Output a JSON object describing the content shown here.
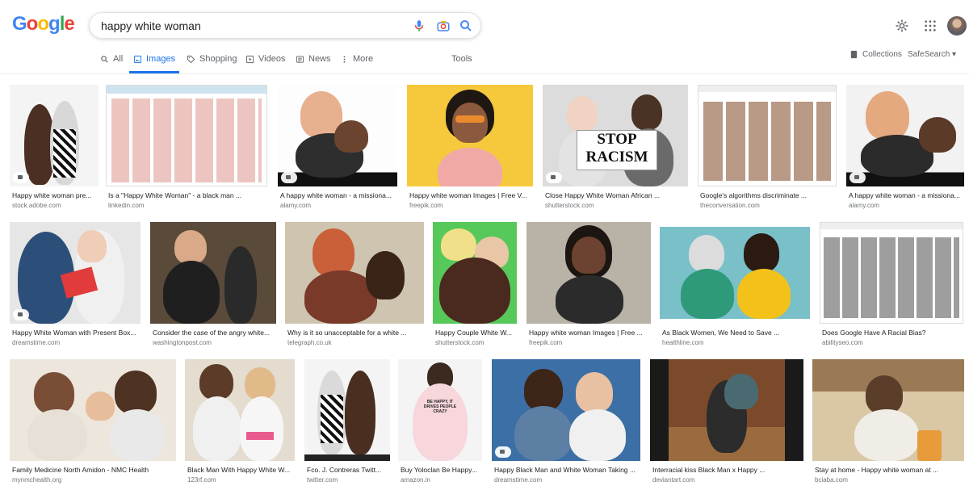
{
  "search": {
    "query": "happy white woman"
  },
  "tabs": [
    {
      "label": "All"
    },
    {
      "label": "Images"
    },
    {
      "label": "Shopping"
    },
    {
      "label": "Videos"
    },
    {
      "label": "News"
    },
    {
      "label": "More"
    }
  ],
  "tools_label": "Tools",
  "collections_label": "Collections",
  "safesearch_label": "SafeSearch",
  "results": [
    {
      "caption": "Happy white woman pre...",
      "source": "stock.adobe.com"
    },
    {
      "caption": "Is a \"Happy White Woman\" - a black man ...",
      "source": "linkedin.com"
    },
    {
      "caption": "A happy white woman - a missiona...",
      "source": "alamy.com"
    },
    {
      "caption": "Happy white woman Images | Free V...",
      "source": "freepik.com"
    },
    {
      "caption": "Close Happy White Woman African ...",
      "source": "shutterstock.com"
    },
    {
      "caption": "Google's algorithms discriminate ...",
      "source": "theconversation.com"
    },
    {
      "caption": "A happy white woman - a missiona...",
      "source": "alamy.com"
    },
    {
      "caption": "Happy White Woman with Present Box...",
      "source": "dreamstime.com"
    },
    {
      "caption": "Consider the case of the angry white...",
      "source": "washingtonpost.com"
    },
    {
      "caption": "Why is it so unacceptable for a white ...",
      "source": "telegraph.co.uk"
    },
    {
      "caption": "Happy Couple White W...",
      "source": "shutterstock.com"
    },
    {
      "caption": "Happy white woman Images | Free ...",
      "source": "freepik.com"
    },
    {
      "caption": "As Black Women, We Need to Save ...",
      "source": "healthline.com"
    },
    {
      "caption": "Does Google Have A Racial Bias?",
      "source": "abilityseo.com"
    },
    {
      "caption": "Family Medicine North Amidon - NMC Health",
      "source": "mynmchealth.org"
    },
    {
      "caption": "Black Man With Happy White W...",
      "source": "123rf.com"
    },
    {
      "caption": "Fco. J. Contreras Twitt...",
      "source": "twitter.com"
    },
    {
      "caption": "Buy Yoloclan Be Happy...",
      "source": "amazon.in"
    },
    {
      "caption": "Happy Black Man and White Woman Taking ...",
      "source": "dreamstime.com"
    },
    {
      "caption": "Interracial kiss Black Man x Happy ...",
      "source": "deviantart.com"
    },
    {
      "caption": "Stay at home - Happy white woman at ...",
      "source": "bciaba.com"
    }
  ],
  "image_text": {
    "stop": "STOP",
    "racism": "RACISM",
    "shirt": "BE HAPPY, IT DRIVES PEOPLE CRAZY"
  }
}
